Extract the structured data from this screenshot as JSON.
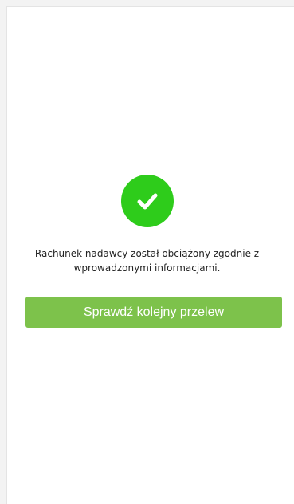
{
  "success": {
    "icon": "checkmark-circle-icon",
    "color": "#2ecc1b"
  },
  "message": {
    "line1": "Rachunek nadawcy został obciążony zgodnie z",
    "line2": "wprowadzonymi informacjami."
  },
  "actions": {
    "next_transfer_label": "Sprawdź kolejny przelew",
    "button_color": "#7dc24b"
  }
}
